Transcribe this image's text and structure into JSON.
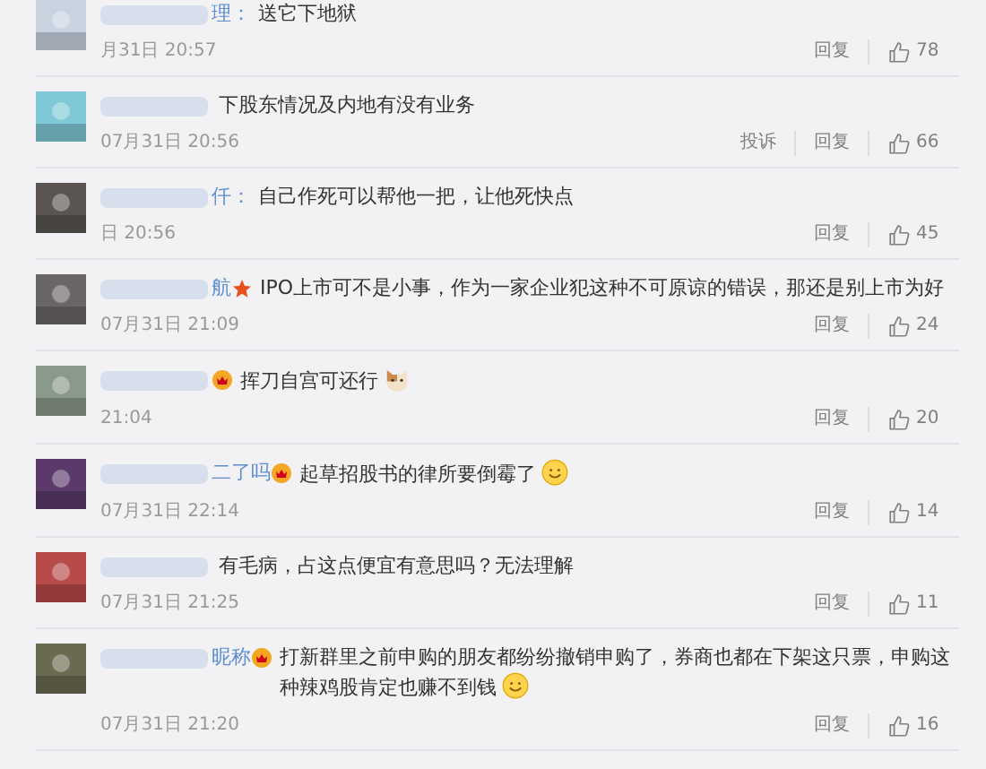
{
  "comments": [
    {
      "name": "理：",
      "text": "送它下地狱",
      "time": "月31日 20:57",
      "actions": [
        "回复"
      ],
      "likes": "78"
    },
    {
      "text": "下股东情况及内地有没有业务",
      "time": "07月31日 20:56",
      "actions": [
        "投诉",
        "回复"
      ],
      "likes": "66"
    },
    {
      "name": "仟：",
      "text": "自己作死可以帮他一把，让他死快点",
      "time": "日 20:56",
      "actions": [
        "回复"
      ],
      "likes": "45"
    },
    {
      "name": "航",
      "badge": {
        "kind": "star"
      },
      "text": "IPO上市可不是小事，作为一家企业犯这种不可原谅的错误，那还是别上市为好",
      "time": "07月31日 21:09",
      "actions": [
        "回复"
      ],
      "likes": "24"
    },
    {
      "badge": {
        "kind": "vip"
      },
      "text": "挥刀自宫可还行",
      "emoji": {
        "kind": "cat"
      },
      "time": "21:04",
      "actions": [
        "回复"
      ],
      "likes": "20"
    },
    {
      "name": "二了吗",
      "badge": {
        "kind": "vip"
      },
      "text": "起草招股书的律所要倒霉了",
      "emoji": {
        "kind": "smile"
      },
      "time": "07月31日 22:14",
      "actions": [
        "回复"
      ],
      "likes": "14"
    },
    {
      "text": "有毛病，占这点便宜有意思吗？无法理解",
      "time": "07月31日 21:25",
      "actions": [
        "回复"
      ],
      "likes": "11"
    },
    {
      "name": "昵称",
      "badge": {
        "kind": "vip"
      },
      "text": "打新群里之前申购的朋友都纷纷撤销申购了，券商也都在下架这只票，申购这种辣鸡股肯定也赚不到钱",
      "emoji": {
        "kind": "smile"
      },
      "time": "07月31日 21:20",
      "actions": [
        "回复"
      ],
      "likes": "16"
    }
  ]
}
